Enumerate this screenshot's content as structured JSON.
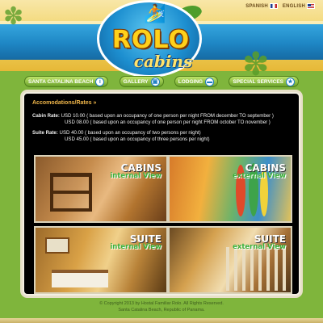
{
  "header": {
    "logo_title": "ROLO",
    "logo_subtitle": "cabins",
    "languages": [
      {
        "label": "SPANISH",
        "flag": "spain-flag-icon"
      },
      {
        "label": "ENGLISH",
        "flag": "usa-flag-icon"
      }
    ]
  },
  "nav": {
    "items": [
      {
        "label": "SANTA CATALINA BEACH",
        "icon": "info-icon"
      },
      {
        "label": "GALLERY",
        "icon": "image-icon"
      },
      {
        "label": "LODGING",
        "icon": "bed-icon"
      },
      {
        "label": "SPECIAL SERVICES",
        "icon": "star-icon"
      }
    ]
  },
  "content": {
    "section_title": "Accomodations/Rates »",
    "cabin_rate": {
      "label": "Cabin Rate:",
      "line1": "USD 10.00  ( based upon an occupancy of one person per night FROM december TO september )",
      "line2": "USD 08.00  ( based upon an occupancy of one person per night FROM october TO november )"
    },
    "suite_rate": {
      "label": "Suite Rate:",
      "line1": "USD 40.00  ( based upon an occupancy of two persons per night)",
      "line2": "USD 45.00  ( based upon an occupancy of three persons per night)"
    },
    "photos": [
      {
        "title": "CABINS",
        "subtitle": "internal View"
      },
      {
        "title": "CABINS",
        "subtitle": "external View"
      },
      {
        "title": "SUITE",
        "subtitle": "internal View"
      },
      {
        "title": "SUITE",
        "subtitle": "external View"
      }
    ]
  },
  "footer": {
    "line1": "© Copyright 2013 by Hostal Familiar Rolo. All Rights Reserved.",
    "line2": "Santa Catalina Beach, Republic of Panama."
  }
}
